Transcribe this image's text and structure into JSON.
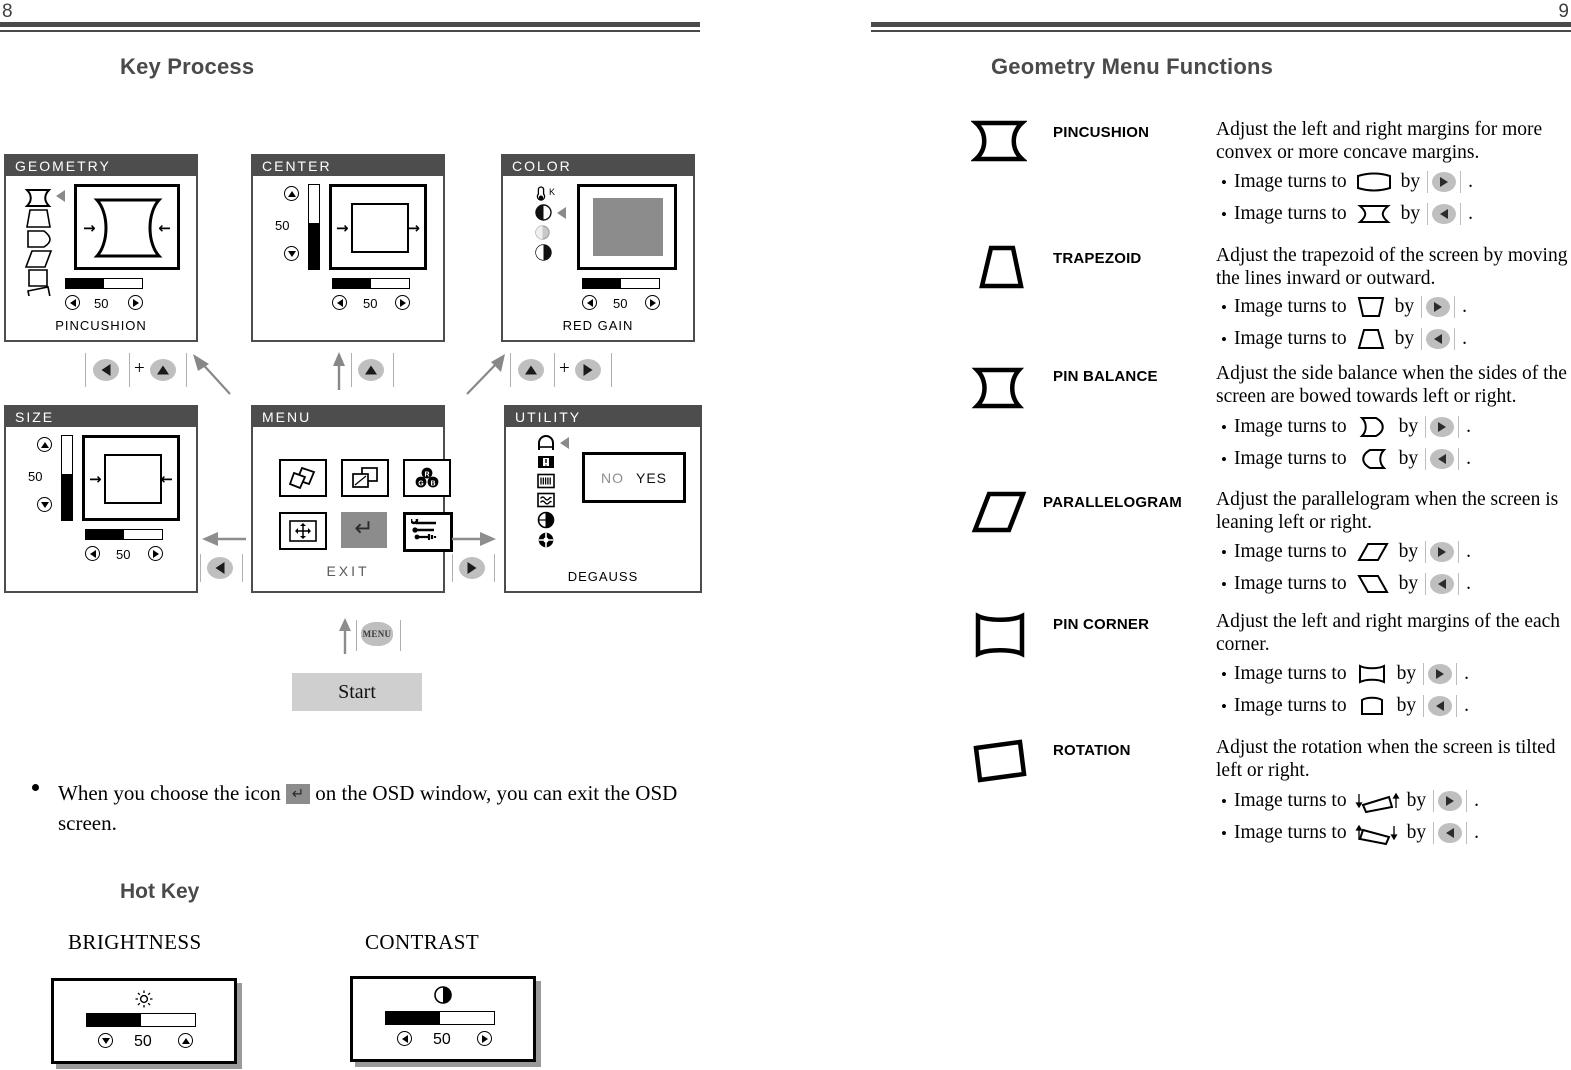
{
  "left_page": {
    "page_number": "8",
    "title": "Key Process",
    "panels": [
      {
        "key": "geometry",
        "title": "GEOMETRY",
        "value": "50",
        "caption": "PINCUSHION"
      },
      {
        "key": "center",
        "title": "CENTER",
        "value": "50",
        "vvalue": "50",
        "caption": ""
      },
      {
        "key": "color",
        "title": "COLOR",
        "value": "50",
        "caption": "RED GAIN"
      },
      {
        "key": "size",
        "title": "SIZE",
        "value": "50",
        "vvalue": "50",
        "caption": ""
      },
      {
        "key": "menu",
        "title": "MENU",
        "caption": "EXIT"
      },
      {
        "key": "utility",
        "title": "UTILITY",
        "caption": "DEGAUSS",
        "choice_no": "NO",
        "choice_yes": "YES"
      }
    ],
    "transitions": {
      "to_geometry": {
        "keys": [
          "left-arrow-key",
          "up-arrow-key"
        ],
        "joiner": "+"
      },
      "to_center": {
        "keys": [
          "up-arrow-key"
        ],
        "joiner": ""
      },
      "to_color": {
        "keys": [
          "up-arrow-key",
          "right-arrow-key"
        ],
        "joiner": "+"
      },
      "menu_to_size": {
        "keys": [
          "left-arrow-key"
        ]
      },
      "menu_to_utility": {
        "keys": [
          "right-arrow-key"
        ]
      },
      "start_to_menu": {
        "keys": [
          "menu-key"
        ],
        "label": "MENU"
      }
    },
    "start_label": "Start",
    "note_before": "When you choose the icon",
    "note_after": "on the OSD window, you can exit the OSD screen.",
    "hotkey_title": "Hot Key",
    "hotkeys": [
      {
        "label": "BRIGHTNESS",
        "value": "50",
        "icon": "brightness-sun-icon",
        "left_key": "down",
        "right_key": "up"
      },
      {
        "label": "CONTRAST",
        "value": "50",
        "icon": "contrast-half-circle-icon",
        "left_key": "left",
        "right_key": "right"
      }
    ]
  },
  "right_page": {
    "page_number": "9",
    "title": "Geometry Menu Functions",
    "entries": [
      {
        "icon": "pincushion-icon",
        "name": "PINCUSHION",
        "description": "Adjust the left and right margins for more convex or more concave margins.",
        "bullets": [
          {
            "text_before": "Image turns to",
            "shape": "convex-barrel-icon",
            "text_mid": "by",
            "key": "right",
            "text_after": "."
          },
          {
            "text_before": "Image turns to",
            "shape": "pincushion-small-icon",
            "text_mid": "by",
            "key": "left",
            "text_after": "."
          }
        ]
      },
      {
        "icon": "trapezoid-icon",
        "name": "TRAPEZOID",
        "description": "Adjust the trapezoid of the screen by moving the lines inward or outward.",
        "bullets": [
          {
            "text_before": "Image turns to",
            "shape": "trapezoid-down-icon",
            "text_mid": "by",
            "key": "right",
            "text_after": "."
          },
          {
            "text_before": "Image turns to",
            "shape": "trapezoid-up-icon",
            "text_mid": "by",
            "key": "left",
            "text_after": "."
          }
        ]
      },
      {
        "icon": "pin-balance-icon",
        "name": "PIN BALANCE",
        "description": "Adjust the side balance when the sides of the screen are bowed towards left or right.",
        "bullets": [
          {
            "text_before": "Image turns to",
            "shape": "bow-right-icon",
            "text_mid": "by",
            "key": "right",
            "text_after": "."
          },
          {
            "text_before": "Image turns to",
            "shape": "bow-left-icon",
            "text_mid": "by",
            "key": "left",
            "text_after": "."
          }
        ]
      },
      {
        "icon": "parallelogram-icon",
        "name": "PARALLELOGRAM",
        "description": "Adjust the parallelogram when the screen is leaning left or right.",
        "bullets": [
          {
            "text_before": "Image turns to",
            "shape": "parallelogram-right-icon",
            "text_mid": "by",
            "key": "right",
            "text_after": "."
          },
          {
            "text_before": "Image turns to",
            "shape": "parallelogram-left-icon",
            "text_mid": "by",
            "key": "left",
            "text_after": "."
          }
        ]
      },
      {
        "icon": "pin-corner-icon",
        "name": "PIN CORNER",
        "description": "Adjust the left and right margins of the each corner.",
        "bullets": [
          {
            "text_before": "Image turns to",
            "shape": "corner-out-icon",
            "text_mid": "by",
            "key": "right",
            "text_after": "."
          },
          {
            "text_before": "Image turns to",
            "shape": "corner-in-icon",
            "text_mid": "by",
            "key": "left",
            "text_after": "."
          }
        ]
      },
      {
        "icon": "rotation-icon",
        "name": "ROTATION",
        "description": "Adjust the rotation when the screen is tilted left or right.",
        "bullets": [
          {
            "text_before": "Image turns to",
            "shape": "rotate-cw-icon",
            "text_mid": "by",
            "key": "right",
            "text_after": "."
          },
          {
            "text_before": "Image turns to",
            "shape": "rotate-ccw-icon",
            "text_mid": "by",
            "key": "left",
            "text_after": "."
          }
        ]
      }
    ]
  },
  "colors": {
    "rule": "#4a4a4a",
    "title": "#4a4a4a",
    "osd_bar": "#4d4d4d",
    "key_grey": "#bfbfbf",
    "start_grey": "#cfcfcf",
    "selected_grey": "#8c8c8c"
  }
}
